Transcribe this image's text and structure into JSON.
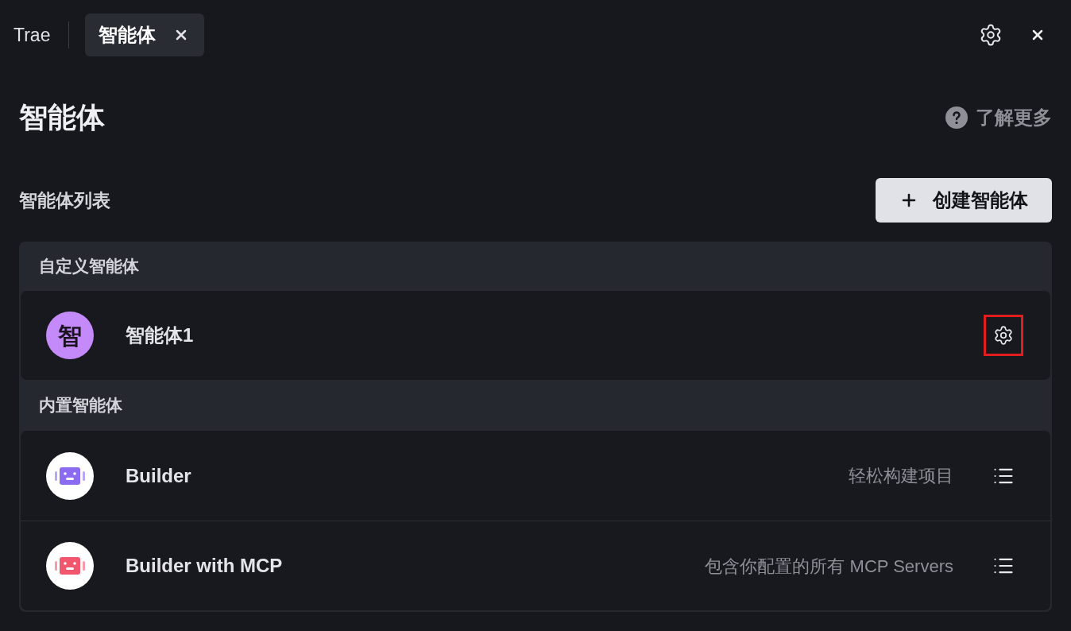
{
  "top_bar": {
    "app_name": "Trae",
    "tabs": [
      {
        "label": "智能体",
        "selected": true
      }
    ]
  },
  "page": {
    "title": "智能体",
    "help_link": "了解更多"
  },
  "agent_list": {
    "heading": "智能体列表",
    "create_button": "创建智能体"
  },
  "sections": [
    {
      "title": "自定义智能体",
      "agents": [
        {
          "name": "智能体1",
          "avatar": {
            "kind": "letter",
            "text": "智",
            "color": "#c58af9"
          },
          "action": {
            "kind": "settings",
            "highlighted": true
          }
        }
      ]
    },
    {
      "title": "内置智能体",
      "agents": [
        {
          "name": "Builder",
          "description": "轻松构建项目",
          "avatar": {
            "kind": "robot",
            "color": "#8b6cf0"
          },
          "action": {
            "kind": "list",
            "highlighted": false
          }
        },
        {
          "name": "Builder with MCP",
          "description": "包含你配置的所有 MCP Servers",
          "avatar": {
            "kind": "robot",
            "color": "#f0566e"
          },
          "action": {
            "kind": "list",
            "highlighted": false
          }
        }
      ]
    }
  ]
}
